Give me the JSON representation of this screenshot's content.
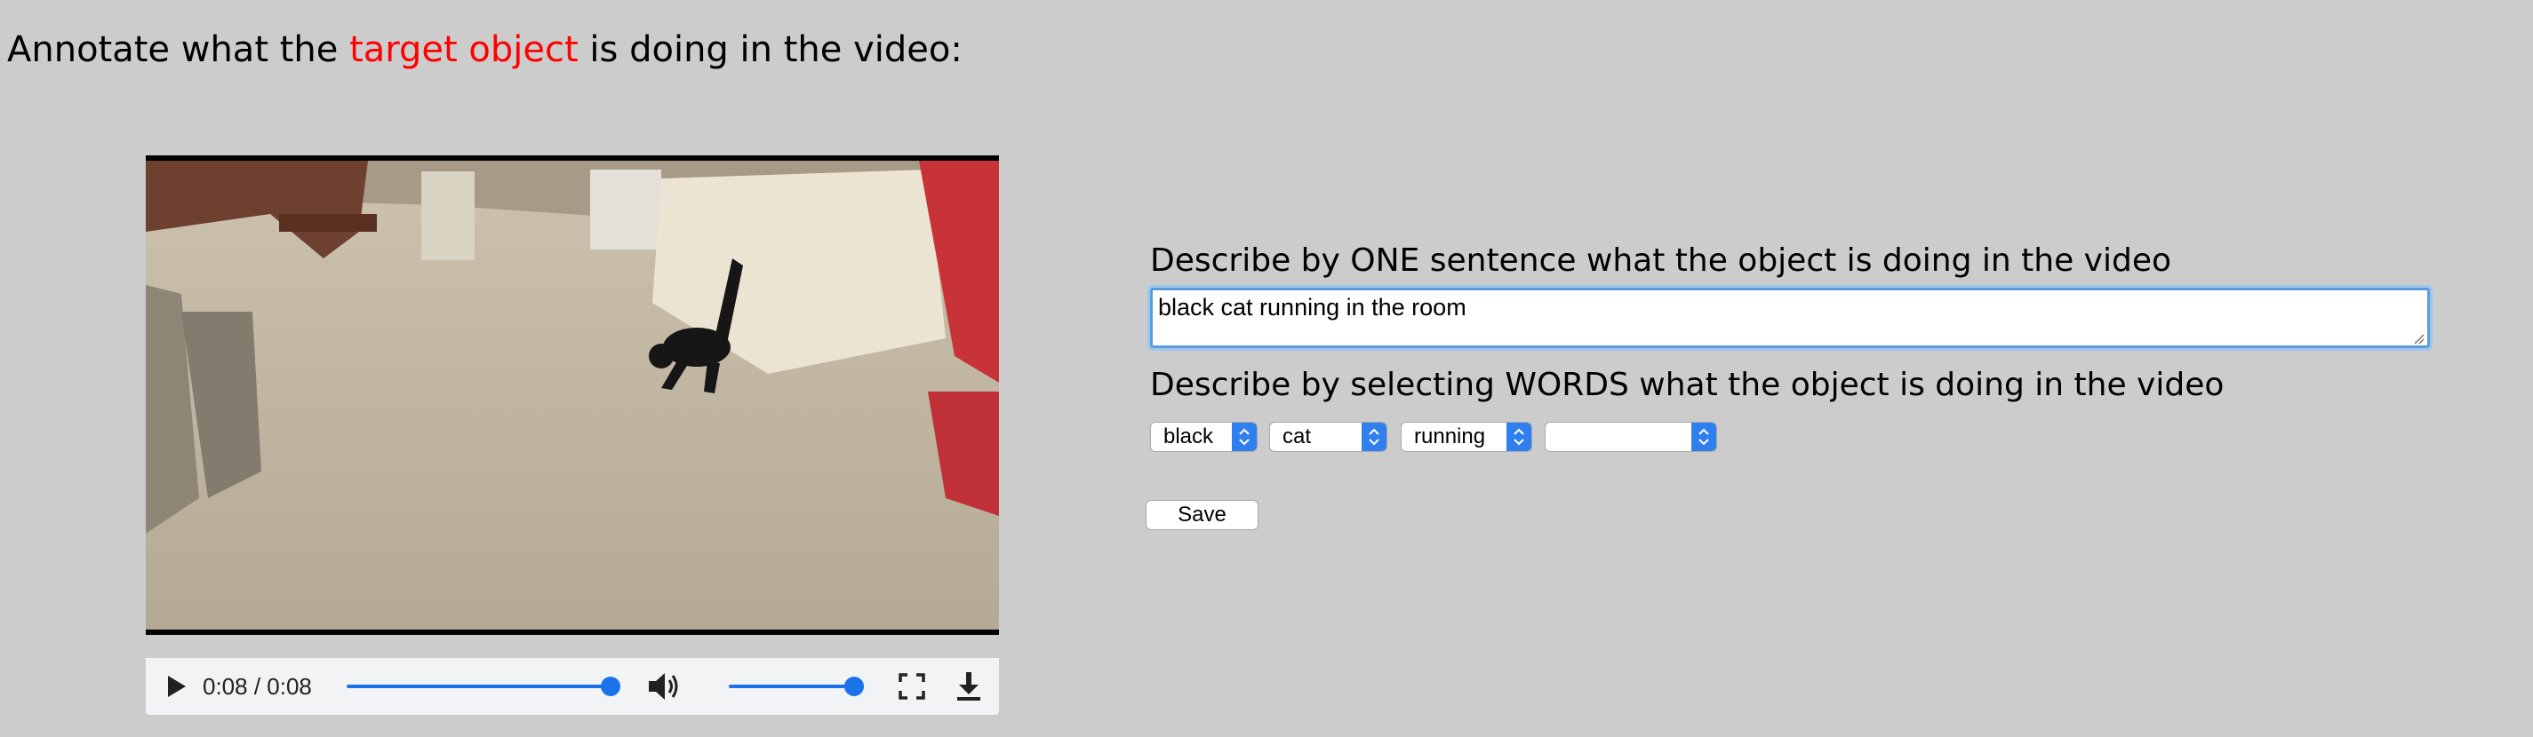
{
  "heading": {
    "prefix": "Annotate what the",
    "highlight": "target object",
    "suffix": "is doing in the video:"
  },
  "video": {
    "time_display": "0:08 / 0:08",
    "progress": 1.0,
    "volume": 1.0,
    "icons": [
      "play-icon",
      "volume-icon",
      "fullscreen-icon",
      "download-icon"
    ]
  },
  "sentence": {
    "label": "Describe by ONE sentence what the object is doing in the video",
    "value": "black cat running in the room"
  },
  "words": {
    "label": "Describe by selecting WORDS what the object is doing in the video",
    "selects": [
      {
        "value": "black"
      },
      {
        "value": "cat"
      },
      {
        "value": "running"
      },
      {
        "value": ""
      }
    ]
  },
  "save_label": "Save",
  "colors": {
    "background": "#cccccc",
    "highlight": "#ff0000",
    "accent": "#1a73e8",
    "select_arrow": "#2f80ee",
    "focus_border": "#5b9dd9"
  }
}
